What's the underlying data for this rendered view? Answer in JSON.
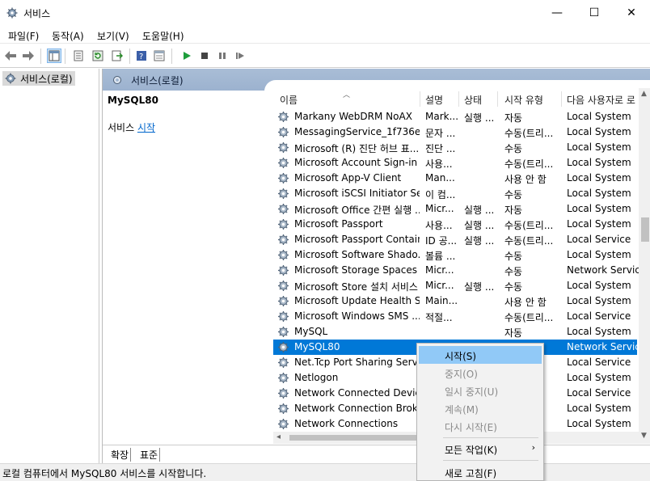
{
  "window": {
    "title": "서비스",
    "minimize": "—",
    "maximize": "☐",
    "close": "✕"
  },
  "menu": [
    "파일(F)",
    "동작(A)",
    "보기(V)",
    "도움말(H)"
  ],
  "tree": {
    "label": "서비스(로컬)"
  },
  "panel": {
    "header": "서비스(로컬)",
    "selected_name": "MySQL80",
    "desc_prefix": "서비스 ",
    "desc_link": "시작"
  },
  "table": {
    "columns": [
      "이름",
      "설명",
      "상태",
      "시작 유형",
      "다음 사용자로 로"
    ],
    "rows": [
      {
        "name": "Markany WebDRM NoAX",
        "desc": "Mark...",
        "status": "실행 ...",
        "startup": "자동",
        "logon": "Local System"
      },
      {
        "name": "MessagingService_1f736e5...",
        "desc": "문자 ...",
        "status": "",
        "startup": "수동(트리...",
        "logon": "Local System"
      },
      {
        "name": "Microsoft (R) 진단 허브 표...",
        "desc": "진단 ...",
        "status": "",
        "startup": "수동",
        "logon": "Local System"
      },
      {
        "name": "Microsoft Account Sign-in ...",
        "desc": "사용...",
        "status": "",
        "startup": "수동(트리...",
        "logon": "Local System"
      },
      {
        "name": "Microsoft App-V Client",
        "desc": "Man...",
        "status": "",
        "startup": "사용 안 함",
        "logon": "Local System"
      },
      {
        "name": "Microsoft iSCSI Initiator Se...",
        "desc": "이 컴...",
        "status": "",
        "startup": "수동",
        "logon": "Local System"
      },
      {
        "name": "Microsoft Office 간편 실행 ...",
        "desc": "Micr...",
        "status": "실행 ...",
        "startup": "자동",
        "logon": "Local System"
      },
      {
        "name": "Microsoft Passport",
        "desc": "사용...",
        "status": "실행 ...",
        "startup": "수동(트리...",
        "logon": "Local System"
      },
      {
        "name": "Microsoft Passport Container",
        "desc": "ID 공...",
        "status": "실행 ...",
        "startup": "수동(트리...",
        "logon": "Local Service"
      },
      {
        "name": "Microsoft Software Shado...",
        "desc": "볼륨 ...",
        "status": "",
        "startup": "수동",
        "logon": "Local System"
      },
      {
        "name": "Microsoft Storage Spaces ...",
        "desc": "Micr...",
        "status": "",
        "startup": "수동",
        "logon": "Network Service"
      },
      {
        "name": "Microsoft Store 설치 서비스",
        "desc": "Micr...",
        "status": "실행 ...",
        "startup": "수동",
        "logon": "Local System"
      },
      {
        "name": "Microsoft Update Health S...",
        "desc": "Main...",
        "status": "",
        "startup": "사용 안 함",
        "logon": "Local System"
      },
      {
        "name": "Microsoft Windows SMS ...",
        "desc": "적절...",
        "status": "",
        "startup": "수동(트리...",
        "logon": "Local Service"
      },
      {
        "name": "MySQL",
        "desc": "",
        "status": "",
        "startup": "자동",
        "logon": "Local System"
      },
      {
        "name": "MySQL80",
        "desc": "",
        "status": "",
        "startup": "",
        "logon": "Network Service"
      },
      {
        "name": "Net.Tcp Port Sharing Service",
        "desc": "",
        "status": "",
        "startup": "함",
        "logon": "Local Service"
      },
      {
        "name": "Netlogon",
        "desc": "",
        "status": "",
        "startup": "",
        "logon": "Local System"
      },
      {
        "name": "Network Connected Device...",
        "desc": "",
        "status": "",
        "startup": "",
        "logon": "Local Service"
      },
      {
        "name": "Network Connection Broker",
        "desc": "",
        "status": "",
        "startup": "",
        "logon": "Local System"
      },
      {
        "name": "Network Connections",
        "desc": "",
        "status": "",
        "startup": "",
        "logon": "Local System"
      }
    ]
  },
  "tabs": [
    "확장",
    "표준"
  ],
  "status_bar": "로컬 컴퓨터에서 MySQL80 서비스를 시작합니다.",
  "context_menu": {
    "start": "시작(S)",
    "stop": "중지(O)",
    "pause": "일시 중지(U)",
    "resume": "계속(M)",
    "restart": "다시 시작(E)",
    "all_tasks": "모든 작업(K)",
    "refresh": "새로 고침(F)",
    "submenu_arrow": "›"
  },
  "colors": {
    "selection": "#0078d7",
    "menu_hover": "#91c9f7",
    "header_band": "#a9bdd6",
    "link": "#0066cc"
  },
  "icons": [
    "services-gear-icon",
    "back-arrow-icon",
    "forward-arrow-icon",
    "console-tree-icon",
    "properties-icon",
    "refresh-icon",
    "export-icon",
    "help-icon",
    "view-icon",
    "play-icon",
    "stop-icon",
    "pause-icon",
    "restart-icon"
  ]
}
